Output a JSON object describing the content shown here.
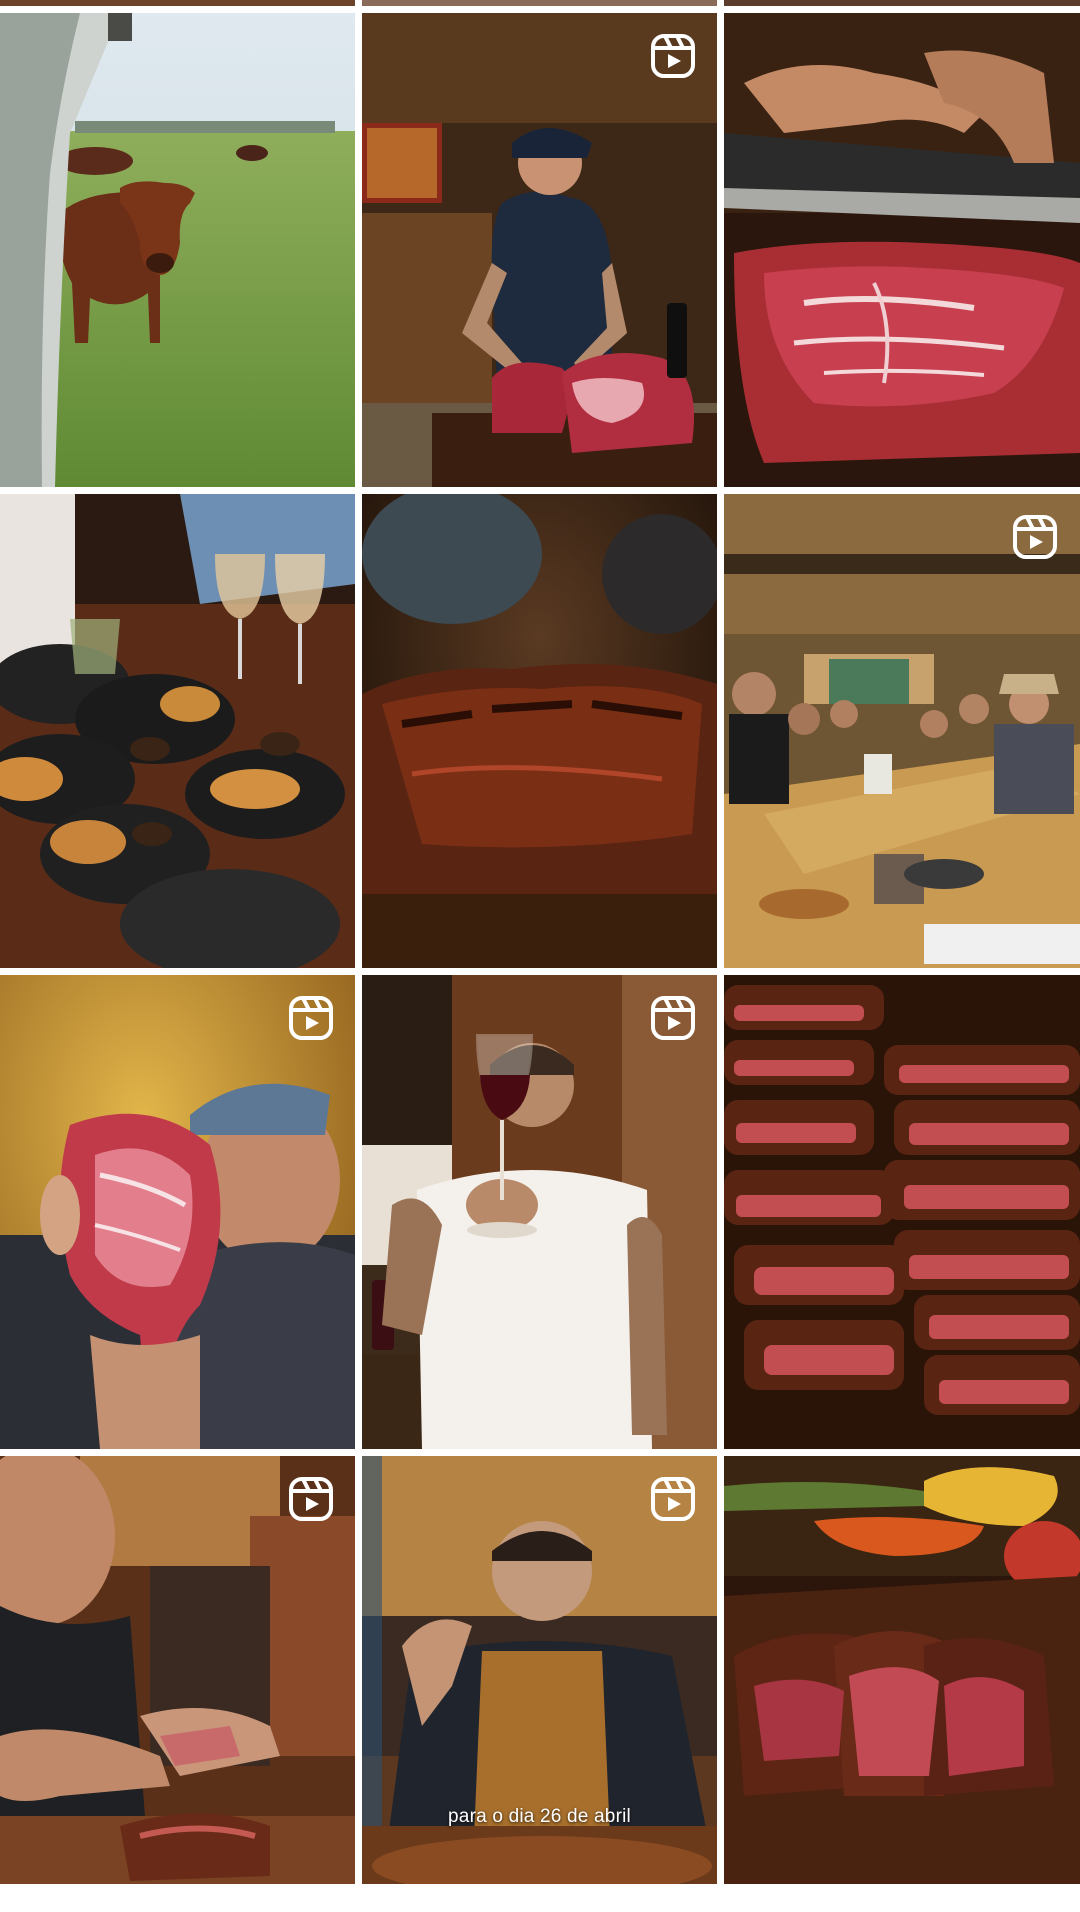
{
  "grid": {
    "tiles": [
      {
        "subject": "cow in pasture",
        "is_reel": false,
        "caption": ""
      },
      {
        "subject": "butcher cutting tomahawk",
        "is_reel": true,
        "caption": ""
      },
      {
        "subject": "knife slicing marbled beef",
        "is_reel": false,
        "caption": ""
      },
      {
        "subject": "dinner table with empanadas and wine",
        "is_reel": false,
        "caption": ""
      },
      {
        "subject": "grilled steak close-up",
        "is_reel": false,
        "caption": ""
      },
      {
        "subject": "restaurant full of guests",
        "is_reel": true,
        "caption": ""
      },
      {
        "subject": "chef holding raw ribeye",
        "is_reel": true,
        "caption": ""
      },
      {
        "subject": "man toasting with red wine",
        "is_reel": true,
        "caption": ""
      },
      {
        "subject": "stack of sliced steaks",
        "is_reel": false,
        "caption": ""
      },
      {
        "subject": "chef slicing steak",
        "is_reel": true,
        "caption": ""
      },
      {
        "subject": "chef in apron at grill",
        "is_reel": true,
        "caption": "para o dia 26 de abril"
      },
      {
        "subject": "sliced steak with grilled vegetables",
        "is_reel": false,
        "caption": ""
      }
    ]
  },
  "icons": {
    "reel": "reels-icon"
  }
}
